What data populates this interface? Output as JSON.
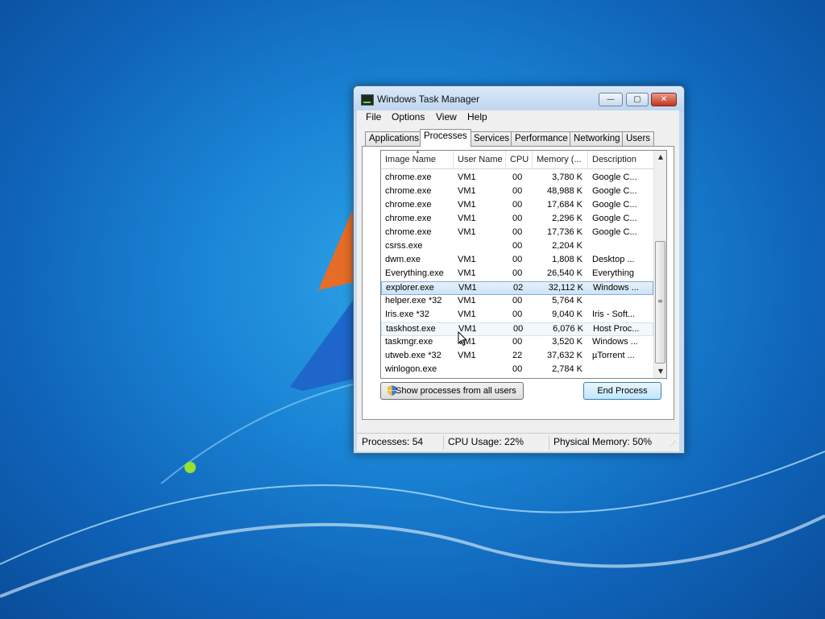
{
  "window": {
    "title": "Windows Task Manager"
  },
  "titlebar_buttons": {
    "min": "—",
    "max": "▢",
    "close": "✕"
  },
  "menu": [
    "File",
    "Options",
    "View",
    "Help"
  ],
  "tabs": [
    {
      "label": "Applications",
      "active": false
    },
    {
      "label": "Processes",
      "active": true
    },
    {
      "label": "Services",
      "active": false
    },
    {
      "label": "Performance",
      "active": false
    },
    {
      "label": "Networking",
      "active": false
    },
    {
      "label": "Users",
      "active": false
    }
  ],
  "columns": {
    "name": "Image Name",
    "user": "User Name",
    "cpu": "CPU",
    "memory": "Memory (...",
    "description": "Description"
  },
  "processes": [
    {
      "name": "chrome.exe",
      "user": "VM1",
      "cpu": "00",
      "memory": "3,780 K",
      "description": "Google C..."
    },
    {
      "name": "chrome.exe",
      "user": "VM1",
      "cpu": "00",
      "memory": "48,988 K",
      "description": "Google C..."
    },
    {
      "name": "chrome.exe",
      "user": "VM1",
      "cpu": "00",
      "memory": "17,684 K",
      "description": "Google C..."
    },
    {
      "name": "chrome.exe",
      "user": "VM1",
      "cpu": "00",
      "memory": "2,296 K",
      "description": "Google C..."
    },
    {
      "name": "chrome.exe",
      "user": "VM1",
      "cpu": "00",
      "memory": "17,736 K",
      "description": "Google C..."
    },
    {
      "name": "csrss.exe",
      "user": "",
      "cpu": "00",
      "memory": "2,204 K",
      "description": ""
    },
    {
      "name": "dwm.exe",
      "user": "VM1",
      "cpu": "00",
      "memory": "1,808 K",
      "description": "Desktop ..."
    },
    {
      "name": "Everything.exe",
      "user": "VM1",
      "cpu": "00",
      "memory": "26,540 K",
      "description": "Everything"
    },
    {
      "name": "explorer.exe",
      "user": "VM1",
      "cpu": "02",
      "memory": "32,112 K",
      "description": "Windows ...",
      "selected": true
    },
    {
      "name": "helper.exe *32",
      "user": "VM1",
      "cpu": "00",
      "memory": "5,764 K",
      "description": ""
    },
    {
      "name": "Iris.exe *32",
      "user": "VM1",
      "cpu": "00",
      "memory": "9,040 K",
      "description": "Iris - Soft..."
    },
    {
      "name": "taskhost.exe",
      "user": "VM1",
      "cpu": "00",
      "memory": "6,076 K",
      "description": "Host Proc...",
      "hover": true
    },
    {
      "name": "taskmgr.exe",
      "user": "VM1",
      "cpu": "00",
      "memory": "3,520 K",
      "description": "Windows ..."
    },
    {
      "name": "utweb.exe *32",
      "user": "VM1",
      "cpu": "22",
      "memory": "37,632 K",
      "description": "µTorrent ..."
    },
    {
      "name": "winlogon.exe",
      "user": "",
      "cpu": "00",
      "memory": "2,784 K",
      "description": ""
    }
  ],
  "buttons": {
    "show_all": "Show processes from all users",
    "end_process": "End Process"
  },
  "status": {
    "processes": "Processes: 54",
    "cpu": "CPU Usage: 22%",
    "memory": "Physical Memory: 50%"
  },
  "colors": {
    "selection": "#cde3f7",
    "titlebar": "#c4dbf1",
    "desktop": "#1b86d6"
  }
}
